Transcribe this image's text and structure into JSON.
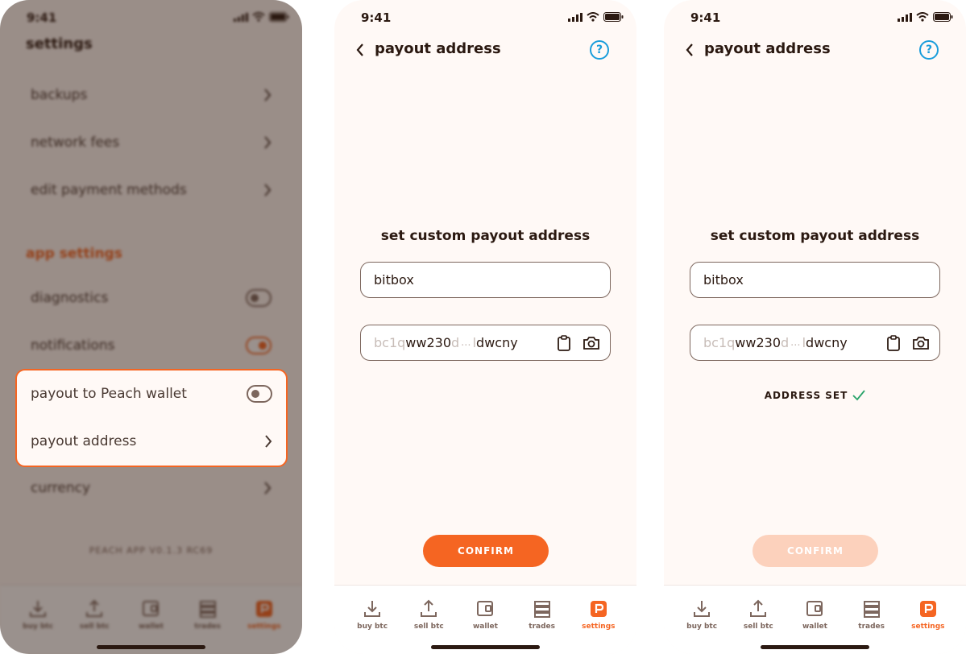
{
  "status_time": "9:41",
  "screen1": {
    "title": "settings",
    "rows": [
      "backups",
      "network fees",
      "edit payment methods"
    ],
    "section_title": "app settings",
    "toggles": [
      {
        "label": "diagnostics",
        "on": false
      },
      {
        "label": "notifications",
        "on": true
      }
    ],
    "highlight": {
      "toggle_label": "payout to Peach wallet",
      "toggle_on": false,
      "link_label": "payout address"
    },
    "currency_label": "currency",
    "version": "PEACH APP V0.1.3 RC69"
  },
  "payout": {
    "header_title": "payout address",
    "help_icon": "question-icon",
    "heading": "set custom payout address",
    "label_value": "bitbox",
    "address": {
      "prefix": "bc1q",
      "highlight": "ww230",
      "mid_fade": "d",
      "ellipsis": "...",
      "after_fade": "l",
      "suffix": "dwcny"
    },
    "address_set_text": "ADDRESS SET",
    "confirm_label": "CONFIRM"
  },
  "nav": {
    "items": [
      {
        "label": "buy btc",
        "icon": "download-icon"
      },
      {
        "label": "sell btc",
        "icon": "upload-icon"
      },
      {
        "label": "wallet",
        "icon": "wallet-icon"
      },
      {
        "label": "trades",
        "icon": "trades-icon"
      },
      {
        "label": "settings",
        "icon": "peach-logo-icon"
      }
    ]
  },
  "colors": {
    "accent": "#f56522",
    "accent_disabled": "#fcd1bc",
    "help": "#1a9ddb",
    "success": "#29a36a",
    "text": "#2b1911",
    "background": "#fff9f6"
  }
}
